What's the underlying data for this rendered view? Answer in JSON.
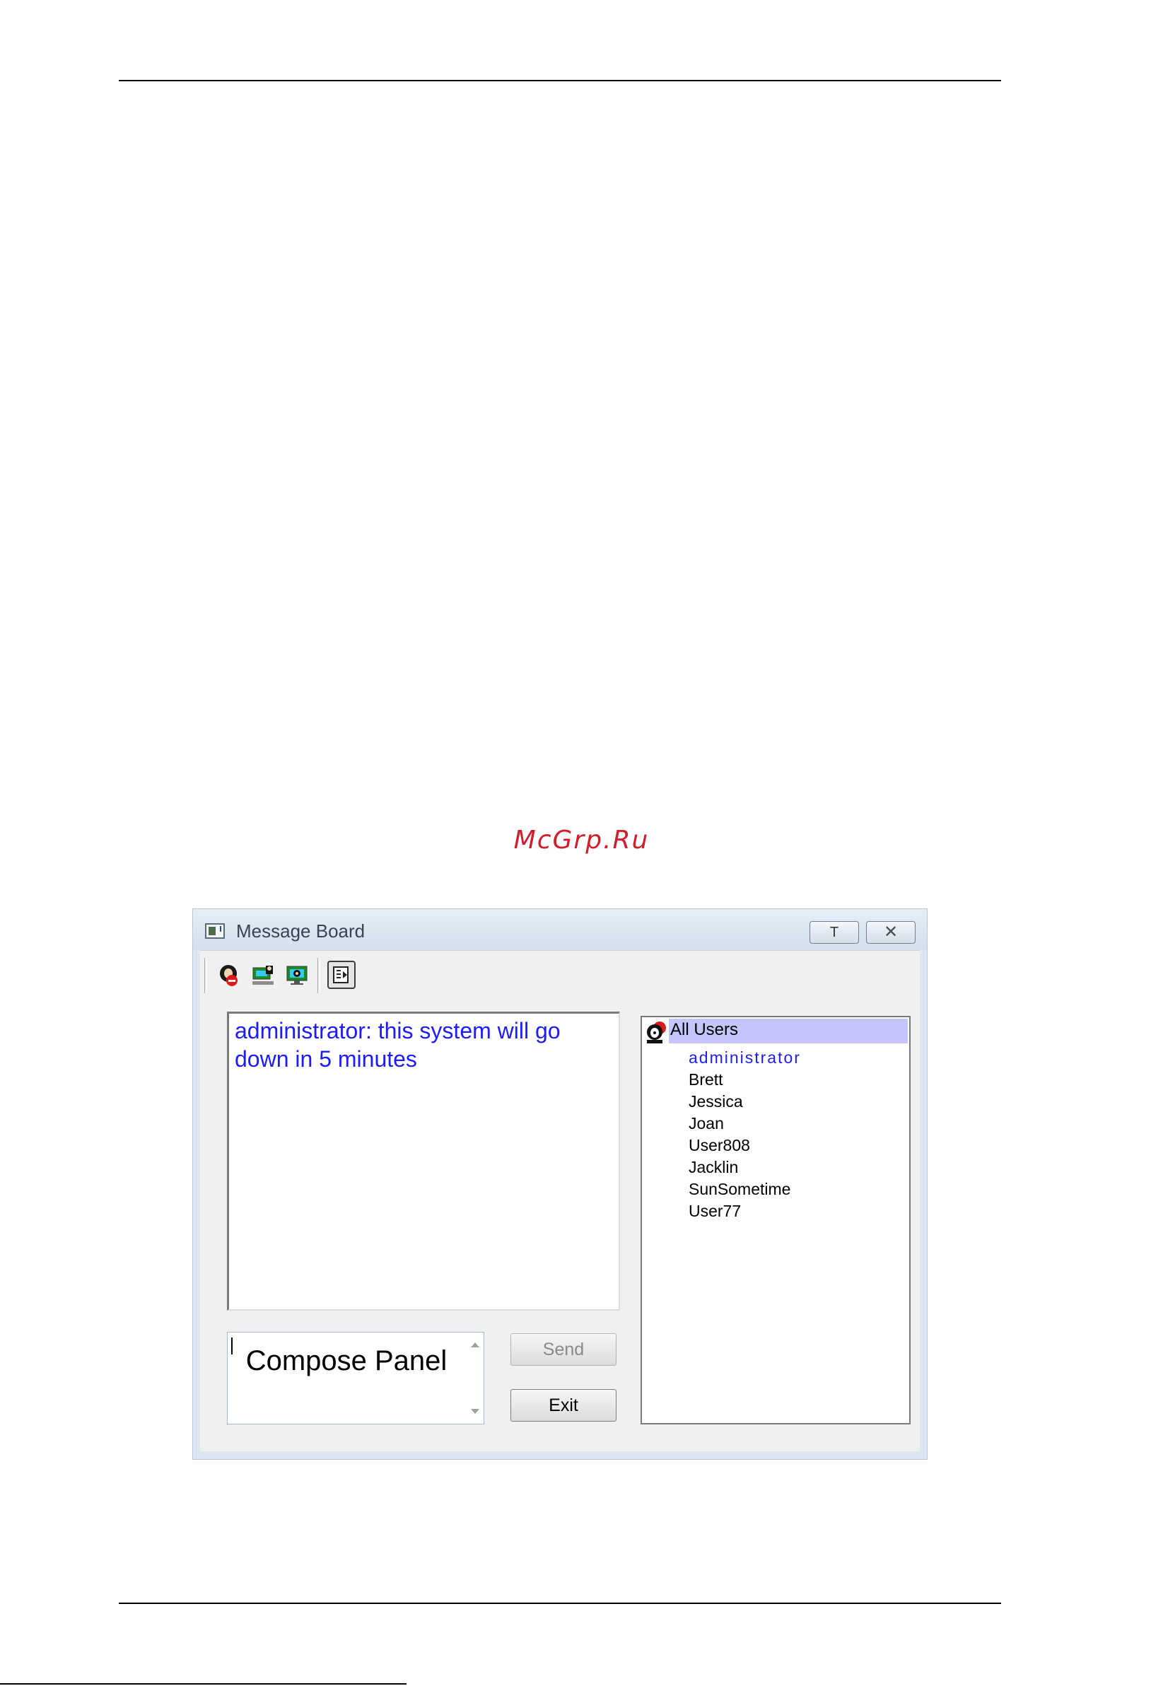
{
  "watermark": "McGrp.Ru",
  "window": {
    "title": "Message Board",
    "pin_label": "T",
    "close_label": "✕"
  },
  "toolbar": {
    "icons": [
      "block-user-icon",
      "user-message-icon",
      "all-users-message-icon",
      "toggle-panel-icon"
    ]
  },
  "message_board": {
    "message": "administrator: this system will go down in 5 minutes",
    "compose_label": "Compose Panel",
    "send_label": "Send",
    "exit_label": "Exit"
  },
  "users": {
    "header": "All Users",
    "list": [
      "administrator",
      "Brett",
      "Jessica",
      "Joan",
      "User808",
      "Jacklin",
      "SunSometime",
      "User77"
    ]
  },
  "colors": {
    "message_text": "#1c1cff",
    "current_user": "#1c1cff",
    "selected_header": "#c6c6ff",
    "watermark": "#cf1f2e"
  }
}
